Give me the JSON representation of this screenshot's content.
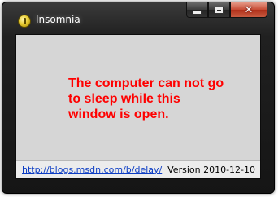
{
  "window": {
    "title": "Insomnia",
    "icon": "insomnia-app-icon",
    "caption_buttons": {
      "minimize_icon": "minimize-icon",
      "maximize_icon": "maximize-icon",
      "close_glyph": "✕"
    }
  },
  "main": {
    "message": "The computer can not go to sleep while this window is open.",
    "message_color": "#ff0000"
  },
  "footer": {
    "link_text": "http://blogs.msdn.com/b/delay/",
    "version_text": "Version 2010-12-10",
    "link_color": "#0b3cc4"
  }
}
